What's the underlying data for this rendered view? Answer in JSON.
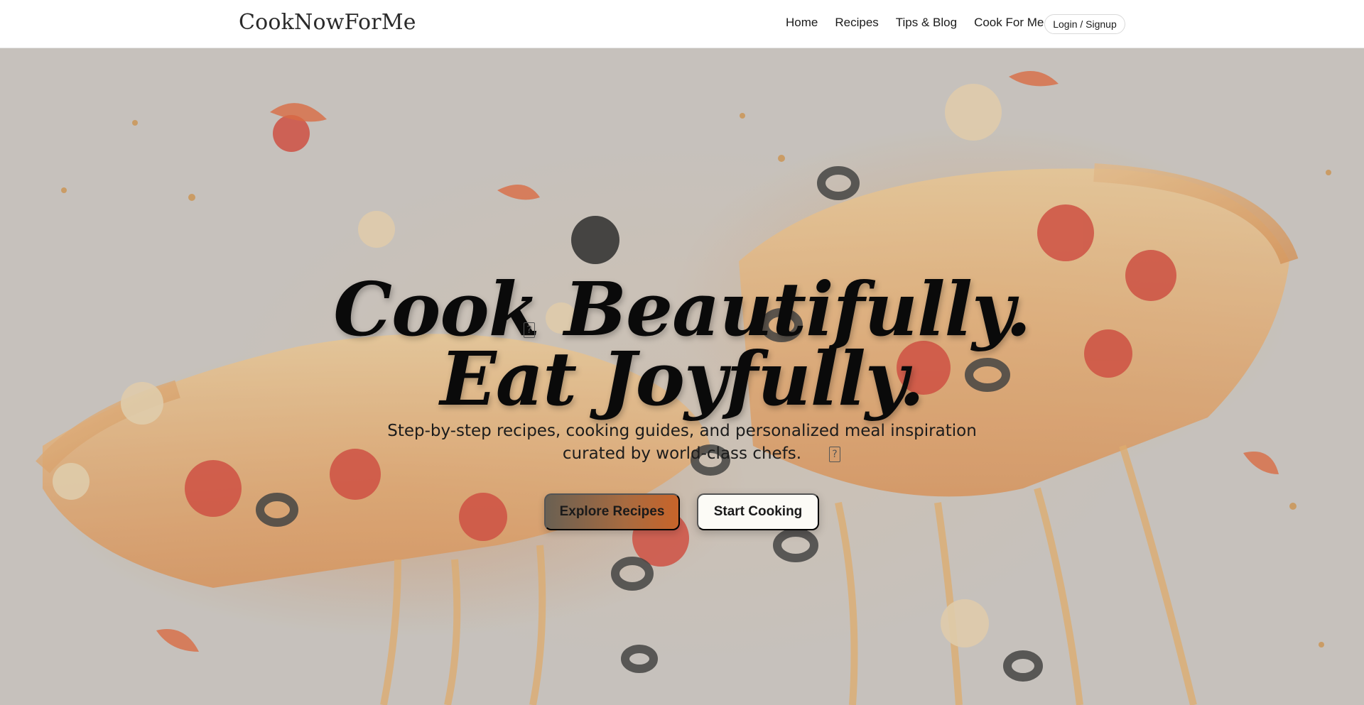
{
  "header": {
    "logo": "CookNowForMe",
    "nav": [
      {
        "label": "Home"
      },
      {
        "label": "Recipes"
      },
      {
        "label": "Tips & Blog"
      },
      {
        "label": "Cook For Me"
      }
    ],
    "login_label": "Login / Signup"
  },
  "hero": {
    "headline_line1": "Cook Beautifully.",
    "headline_line2": "Eat Joyfully.",
    "subtitle_line1": "Step-by-step recipes, cooking guides, and personalized meal inspiration",
    "subtitle_line2": "curated by world-class chefs.",
    "missing_glyph": "?",
    "primary_button": "Explore Recipes",
    "secondary_button": "Start Cooking"
  },
  "colors": {
    "accent_gradient_start": "#6a6052",
    "accent_gradient_end": "#c8642a",
    "secondary_button_bg": "#fcfbf6"
  }
}
